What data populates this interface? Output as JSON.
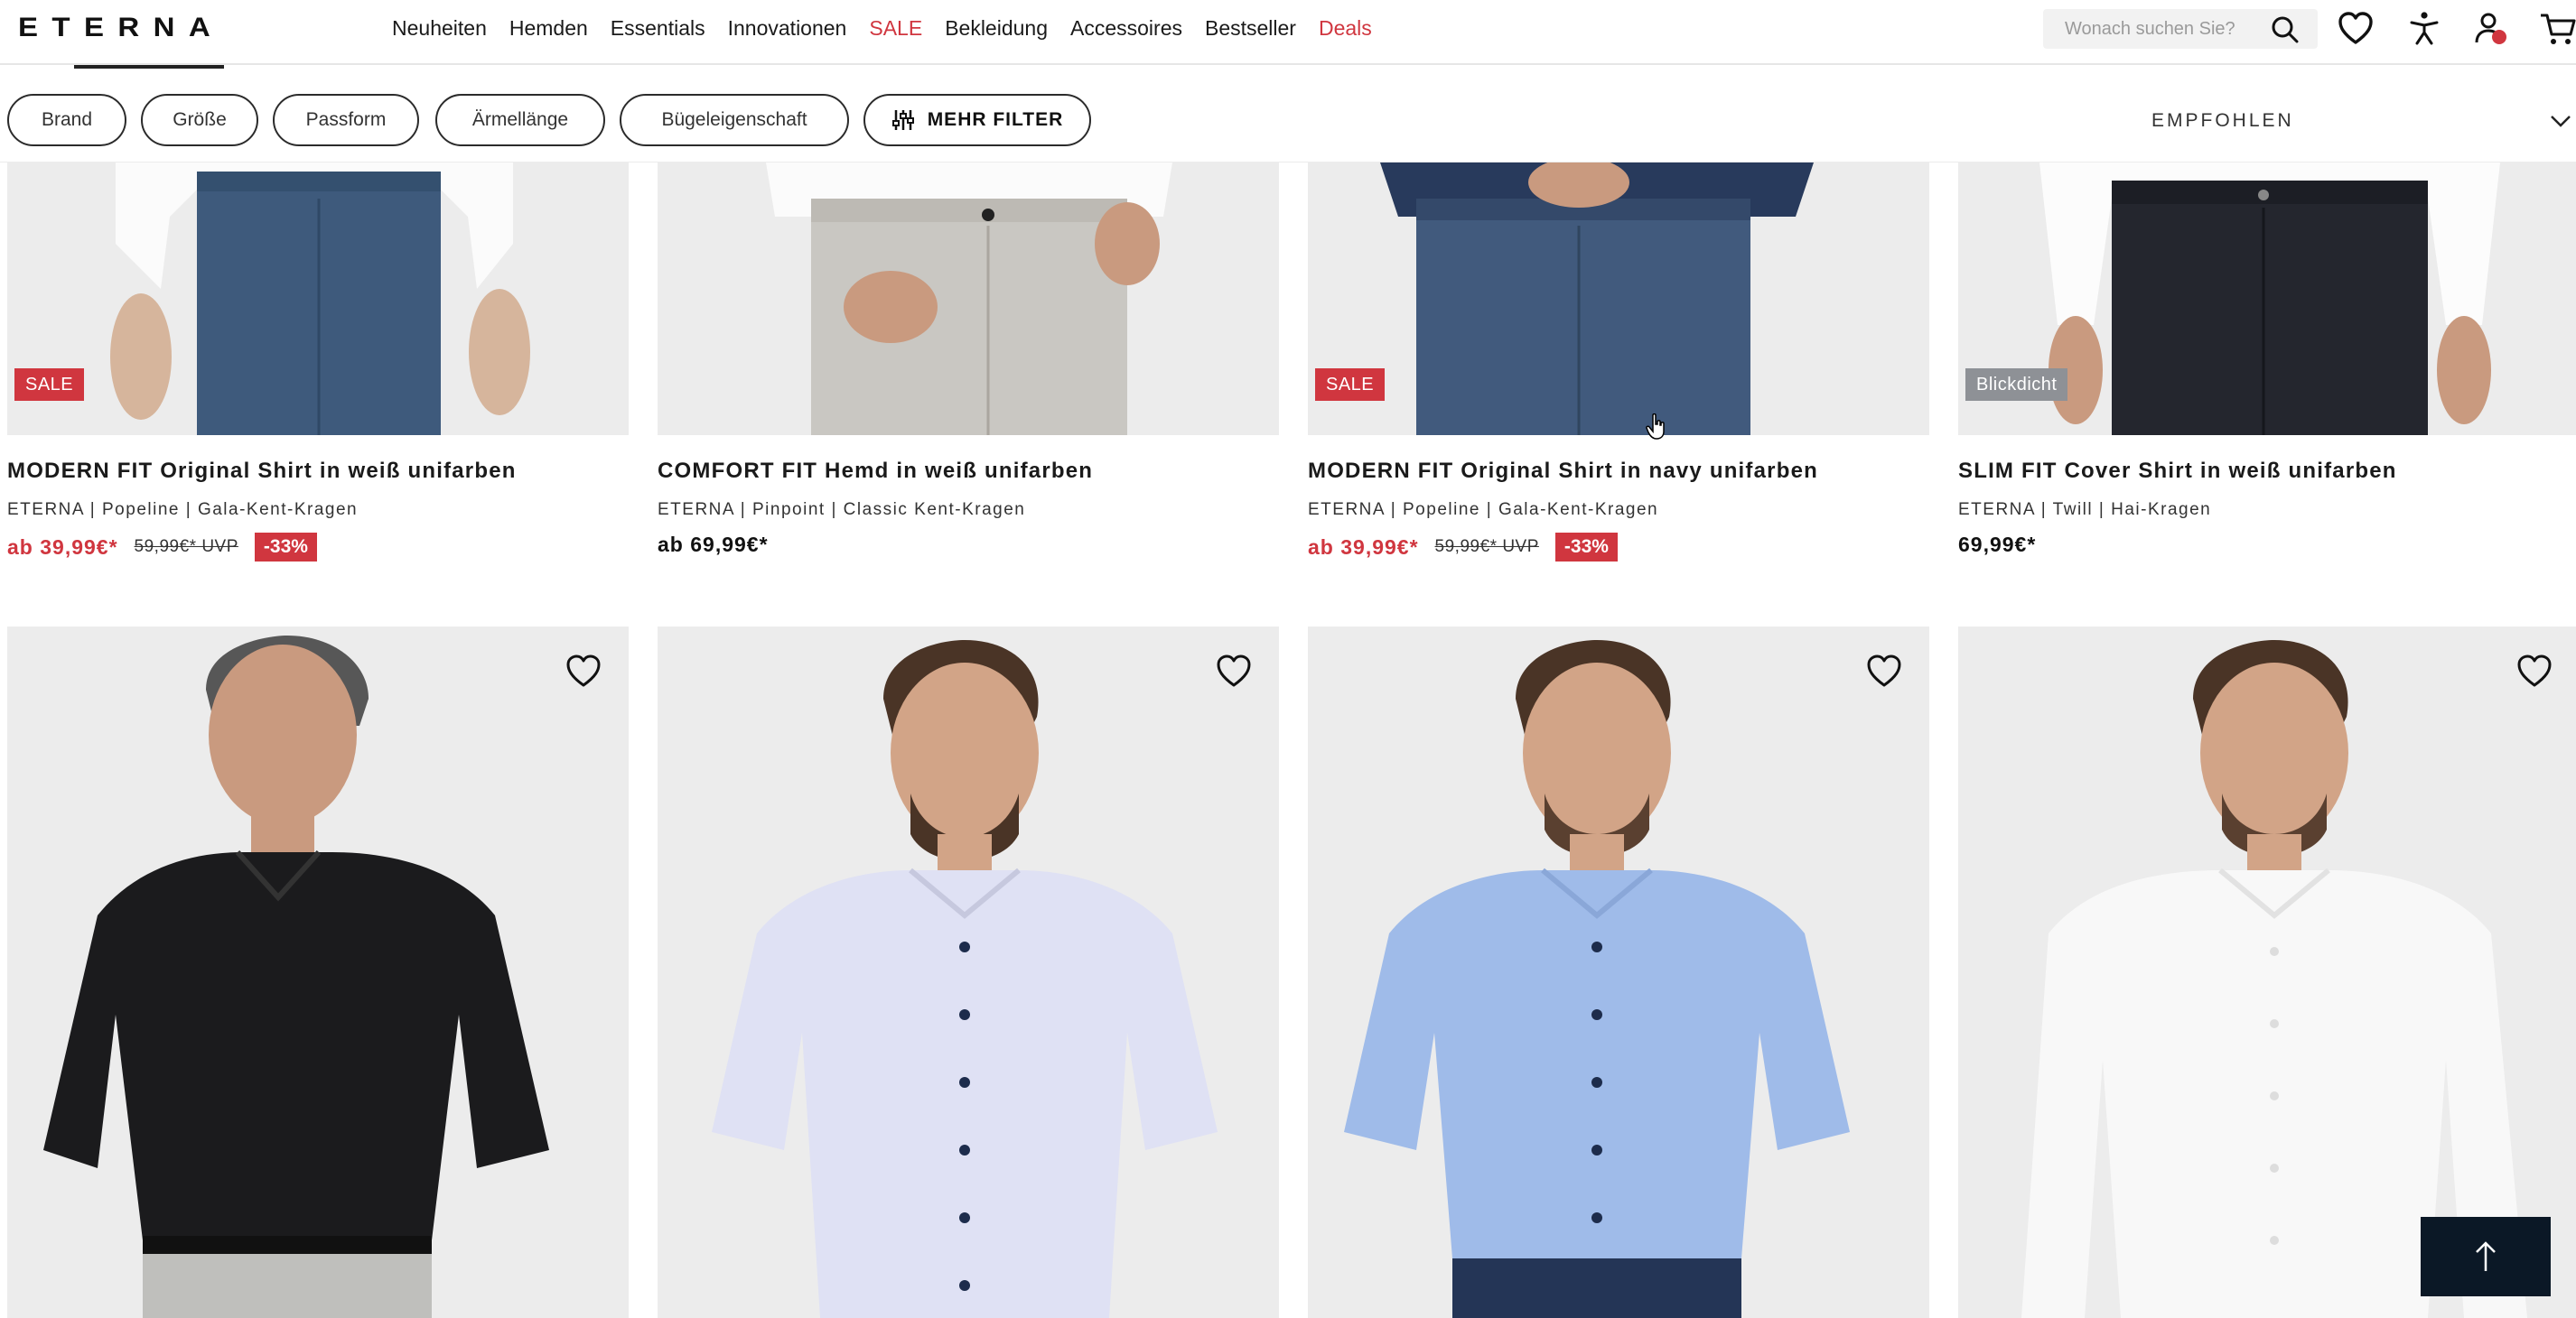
{
  "brand": {
    "logo": "ETERNA"
  },
  "nav": [
    {
      "label": "Neuheiten",
      "highlight": false
    },
    {
      "label": "Hemden",
      "highlight": false
    },
    {
      "label": "Essentials",
      "highlight": false
    },
    {
      "label": "Innovationen",
      "highlight": false
    },
    {
      "label": "SALE",
      "highlight": true
    },
    {
      "label": "Bekleidung",
      "highlight": false
    },
    {
      "label": "Accessoires",
      "highlight": false
    },
    {
      "label": "Bestseller",
      "highlight": false
    },
    {
      "label": "Deals",
      "highlight": true
    }
  ],
  "search": {
    "placeholder": "Wonach suchen Sie?"
  },
  "header_icons": [
    "search-icon",
    "heart-icon",
    "accessibility-icon",
    "account-icon",
    "cart-icon"
  ],
  "filters": {
    "chips": [
      "Brand",
      "Größe",
      "Passform",
      "Ärmellänge",
      "Bügeleigenschaft"
    ],
    "more_label": "MEHR FILTER",
    "sort_label": "EMPFOHLEN"
  },
  "colors": {
    "accent_red": "#d0363f",
    "badge_grey": "#8e9196",
    "back_to_top": "#0b1826"
  },
  "products_row1": [
    {
      "badge": "SALE",
      "badge_type": "sale",
      "title": "MODERN FIT Original Shirt in weiß unifarben",
      "meta": "ETERNA | Popeline | Gala-Kent-Kragen",
      "price": "ab 39,99€*",
      "old_price": "59,99€* UVP",
      "discount": "-33%"
    },
    {
      "badge": "",
      "badge_type": "",
      "title": "COMFORT FIT Hemd in weiß unifarben",
      "meta": "ETERNA | Pinpoint | Classic Kent-Kragen",
      "price": "ab 69,99€*",
      "old_price": "",
      "discount": ""
    },
    {
      "badge": "SALE",
      "badge_type": "sale",
      "title": "MODERN FIT Original Shirt in navy unifarben",
      "meta": "ETERNA | Popeline | Gala-Kent-Kragen",
      "price": "ab 39,99€*",
      "old_price": "59,99€* UVP",
      "discount": "-33%"
    },
    {
      "badge": "Blickdicht",
      "badge_type": "grey",
      "title": "SLIM FIT Cover Shirt in weiß unifarben",
      "meta": "ETERNA | Twill | Hai-Kragen",
      "price": "69,99€*",
      "old_price": "",
      "discount": ""
    }
  ],
  "products_row2": [
    {
      "shirt": "black short-sleeve shirt",
      "shirt_color": "#1b1b1d"
    },
    {
      "shirt": "light lavender short-sleeve shirt",
      "shirt_color": "#dfe1f4"
    },
    {
      "shirt": "light blue short-sleeve shirt",
      "shirt_color": "#9fbbe9"
    },
    {
      "shirt": "white long-sleeve shirt",
      "shirt_color": "#f8f8f8"
    }
  ]
}
